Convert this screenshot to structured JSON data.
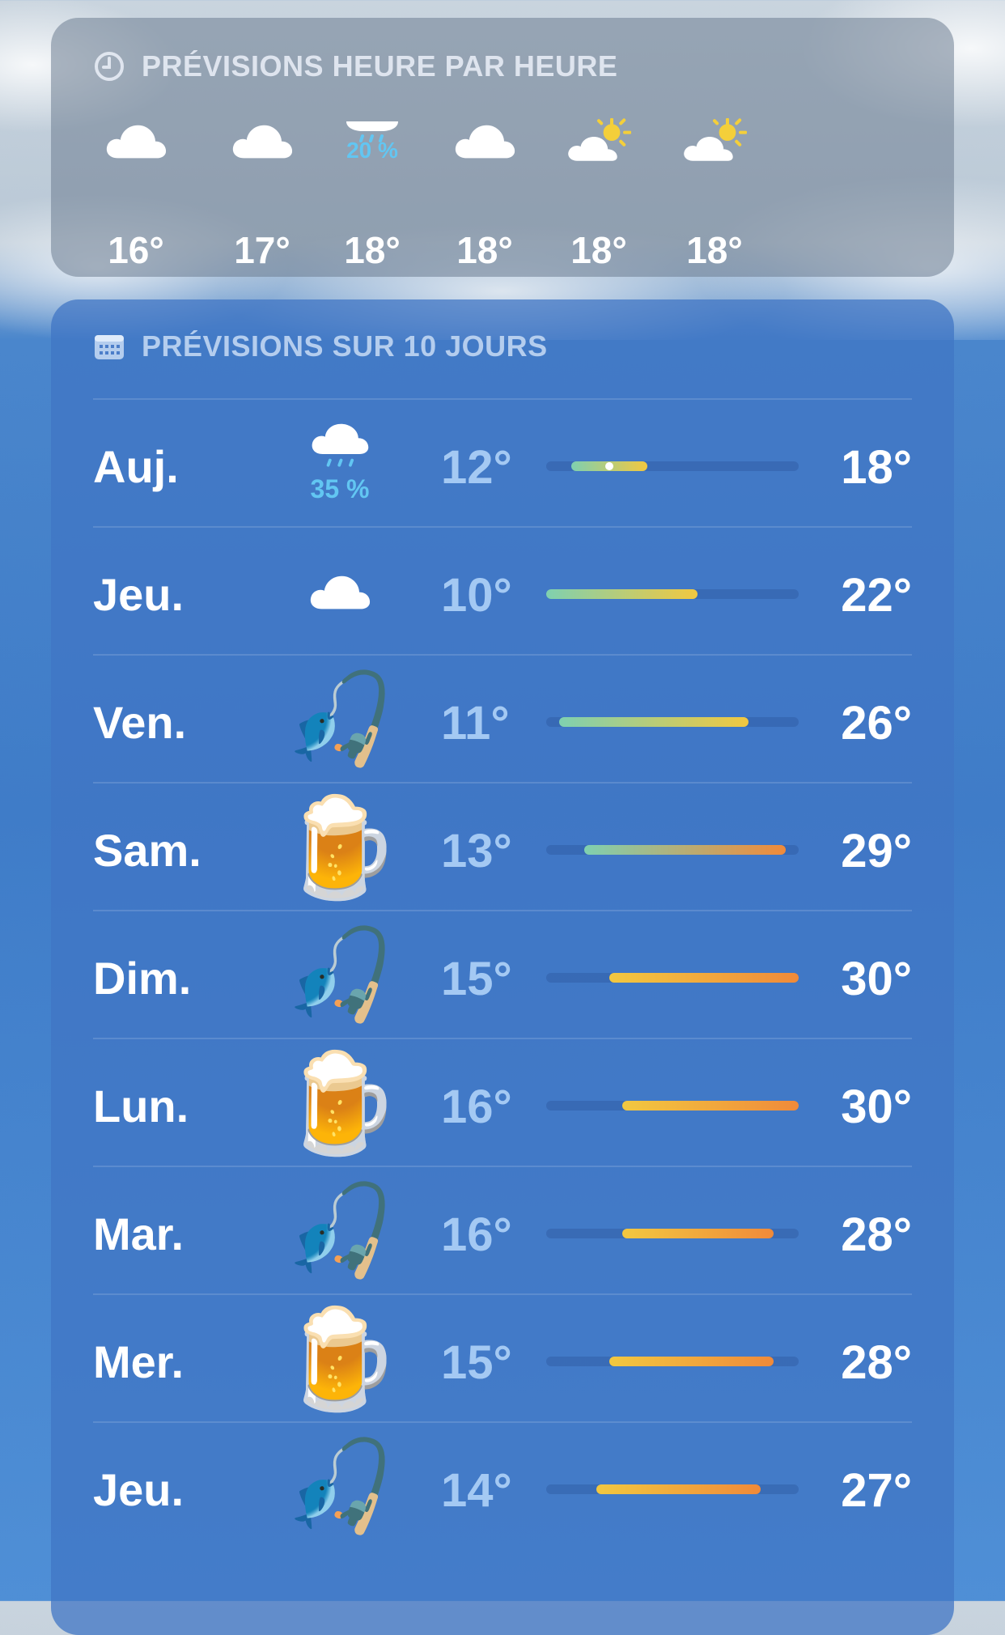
{
  "hourly": {
    "title": "PRÉVISIONS HEURE PAR HEURE",
    "icon": "clock-icon",
    "items": [
      {
        "icon": "cloud-icon",
        "prob": "",
        "temp": "16°"
      },
      {
        "icon": "cloud-icon",
        "prob": "",
        "temp": "17°"
      },
      {
        "icon": "rain-cloud-icon",
        "prob": "20 %",
        "temp": "18°"
      },
      {
        "icon": "cloud-icon",
        "prob": "",
        "temp": "18°"
      },
      {
        "icon": "partly-sunny-icon",
        "prob": "",
        "temp": "18°"
      },
      {
        "icon": "partly-sunny-icon",
        "prob": "",
        "temp": "18°"
      }
    ]
  },
  "daily": {
    "title": "PRÉVISIONS SUR 10 JOURS",
    "icon": "calendar-icon",
    "range": [
      10,
      30
    ],
    "days": [
      {
        "day": "Auj.",
        "icon": "rain-cloud-icon",
        "prob": "35 %",
        "low": "12°",
        "high": "18°",
        "lowv": 12,
        "highv": 18,
        "current": 15
      },
      {
        "day": "Jeu.",
        "icon": "cloud-icon",
        "prob": "",
        "low": "10°",
        "high": "22°",
        "lowv": 10,
        "highv": 22
      },
      {
        "day": "Ven.",
        "icon": "fishing-pole-icon",
        "emoji": "🎣",
        "prob": "",
        "low": "11°",
        "high": "26°",
        "lowv": 11,
        "highv": 26
      },
      {
        "day": "Sam.",
        "icon": "beer-mug-icon",
        "emoji": "🍺",
        "prob": "",
        "low": "13°",
        "high": "29°",
        "lowv": 13,
        "highv": 29
      },
      {
        "day": "Dim.",
        "icon": "fishing-pole-icon",
        "emoji": "🎣",
        "prob": "",
        "low": "15°",
        "high": "30°",
        "lowv": 15,
        "highv": 30
      },
      {
        "day": "Lun.",
        "icon": "beer-mug-icon",
        "emoji": "🍺",
        "prob": "",
        "low": "16°",
        "high": "30°",
        "lowv": 16,
        "highv": 30
      },
      {
        "day": "Mar.",
        "icon": "fishing-pole-icon",
        "emoji": "🎣",
        "prob": "",
        "low": "16°",
        "high": "28°",
        "lowv": 16,
        "highv": 28
      },
      {
        "day": "Mer.",
        "icon": "beer-mug-icon",
        "emoji": "🍺",
        "prob": "",
        "low": "15°",
        "high": "28°",
        "lowv": 15,
        "highv": 28
      },
      {
        "day": "Jeu.",
        "icon": "fishing-pole-icon",
        "emoji": "🎣",
        "prob": "",
        "low": "14°",
        "high": "27°",
        "lowv": 14,
        "highv": 27
      }
    ]
  },
  "colors": {
    "precip": "#62c6f2",
    "bar_cool": "#7fd0b0",
    "bar_warm": "#f2c840",
    "bar_hot": "#f08a3a"
  }
}
